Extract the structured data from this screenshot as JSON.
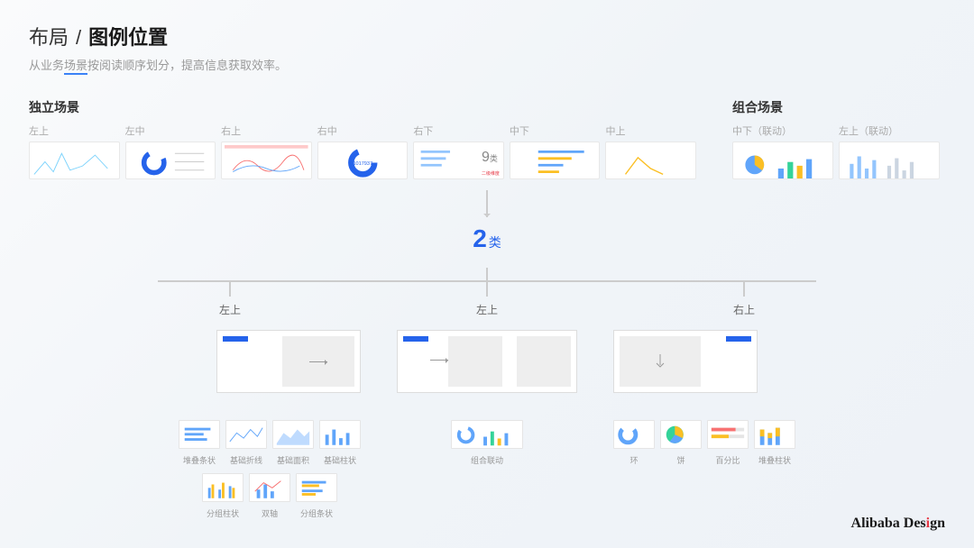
{
  "header": {
    "title_prefix": "布局",
    "title_sep": "/",
    "title_main": "图例位置",
    "subtitle_pre": "从业务",
    "subtitle_underline": "场景",
    "subtitle_post": "按阅读顺序划分，提高信息获取效率。"
  },
  "sections": {
    "independent": {
      "title": "独立场景",
      "positions": [
        "左上",
        "左中",
        "右上",
        "右中",
        "右下",
        "中下",
        "中上"
      ]
    },
    "combined": {
      "title": "组合场景",
      "positions": [
        "中下（联动）",
        "左上（联动）"
      ]
    }
  },
  "center_badge": {
    "inline_num": "9",
    "inline_suffix": "类",
    "main_num": "2",
    "main_suffix": "类"
  },
  "branches": {
    "labels": [
      "左上",
      "左上",
      "右上"
    ]
  },
  "chart_data": {
    "type": "table",
    "note": "Mini chart thumbnails are decorative previews; only their type labels are data.",
    "groups": [
      {
        "row1": [
          "堆叠条状",
          "基础折线",
          "基础面积",
          "基础柱状"
        ],
        "row2": [
          "分组柱状",
          "双轴",
          "分组条状"
        ]
      },
      {
        "row1": [
          "组合联动"
        ]
      },
      {
        "row1": [
          "环",
          "饼",
          "百分比",
          "堆叠柱状"
        ]
      }
    ]
  },
  "brand": {
    "prefix": "Alibaba Des",
    "accent": "i",
    "suffix": "gn"
  }
}
